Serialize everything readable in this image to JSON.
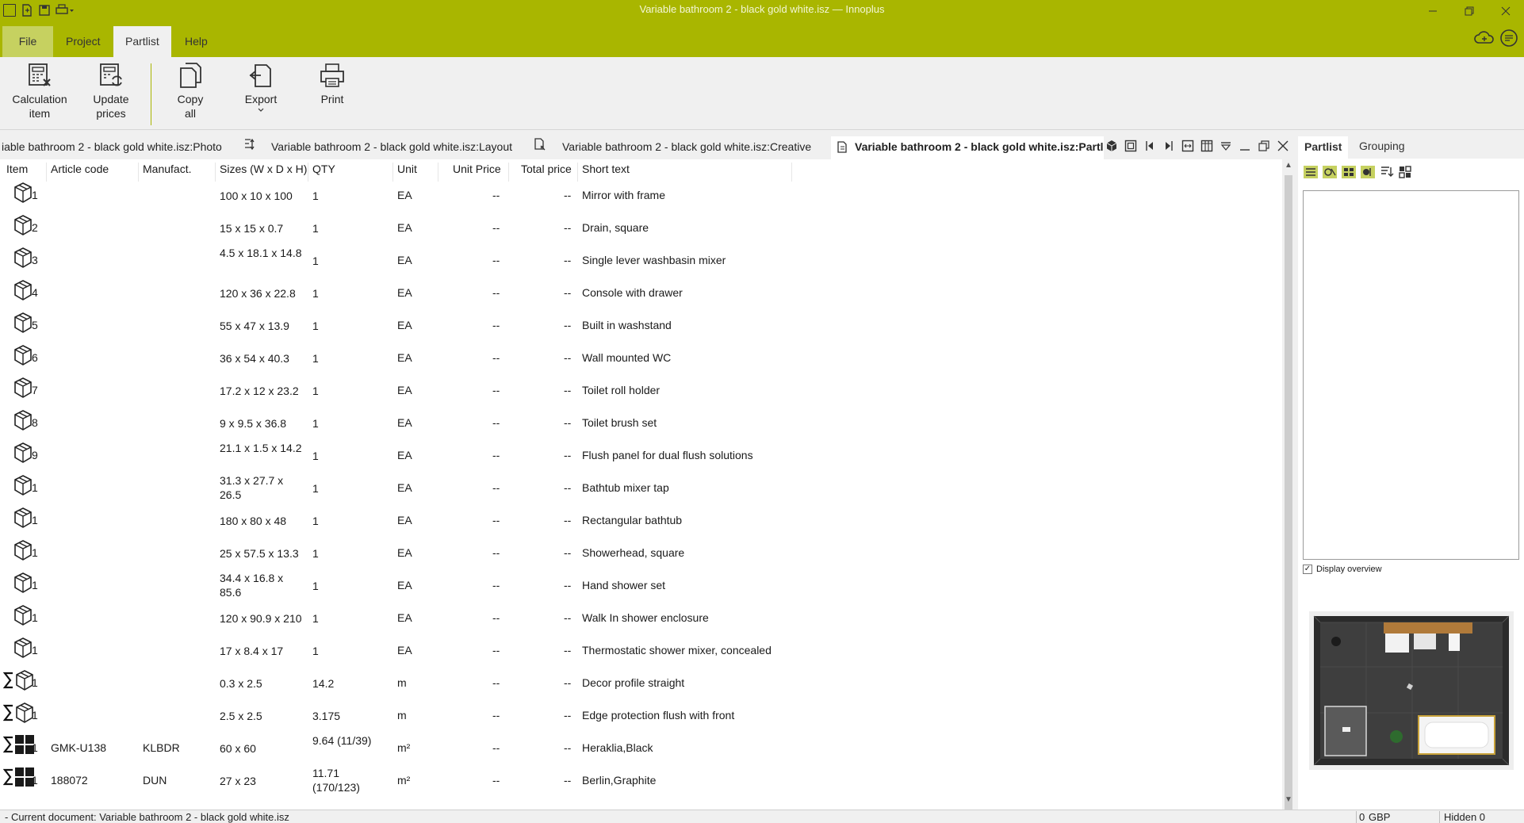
{
  "window": {
    "title": "Variable bathroom 2 - black gold white.isz — Innoplus",
    "controls": [
      "minimize",
      "restore",
      "close"
    ]
  },
  "colors": {
    "accent": "#a9b600",
    "file_tab": "#c6d160"
  },
  "menu": {
    "tabs": [
      {
        "label": "File"
      },
      {
        "label": "Project"
      },
      {
        "label": "Partlist"
      },
      {
        "label": "Help"
      }
    ],
    "active": "Partlist"
  },
  "ribbon": {
    "calc_line1": "Calculation",
    "calc_line2": "item",
    "update_line1": "Update",
    "update_line2": "prices",
    "copy_line1": "Copy",
    "copy_line2": "all",
    "export": "Export",
    "print": "Print"
  },
  "doc_tabs": [
    {
      "label": "iable bathroom 2 - black gold white.isz:Photo"
    },
    {
      "label": "Variable bathroom 2 - black gold white.isz:Layout"
    },
    {
      "label": "Variable bathroom 2 - black gold white.isz:Creative"
    },
    {
      "label": "Variable bathroom 2 - black gold white.isz:Partl"
    }
  ],
  "grid": {
    "columns": [
      "Item",
      "Article code",
      "Manufact.",
      "Sizes (W x D x H)",
      "QTY",
      "Unit",
      "Unit Price",
      "Total price",
      "Short text"
    ],
    "rows": [
      {
        "icon": "box",
        "item": "1",
        "article": "",
        "manuf": "",
        "size": "100 x 10 x 100",
        "qty": "1",
        "unit": "EA",
        "unit_price": "--",
        "total_price": "--",
        "text": "Mirror with frame"
      },
      {
        "icon": "box",
        "item": "2",
        "article": "",
        "manuf": "",
        "size": "15 x 15 x 0.7",
        "qty": "1",
        "unit": "EA",
        "unit_price": "--",
        "total_price": "--",
        "text": "Drain, square"
      },
      {
        "icon": "box",
        "item": "3",
        "article": "",
        "manuf": "",
        "size": "4.5 x 18.1 x 14.8",
        "qty": "1",
        "unit": "EA",
        "unit_price": "--",
        "total_price": "--",
        "text": "Single lever washbasin mixer"
      },
      {
        "icon": "box",
        "item": "4",
        "article": "",
        "manuf": "",
        "size": "120 x 36 x 22.8",
        "qty": "1",
        "unit": "EA",
        "unit_price": "--",
        "total_price": "--",
        "text": "Console with drawer"
      },
      {
        "icon": "box",
        "item": "5",
        "article": "",
        "manuf": "",
        "size": "55 x 47 x 13.9",
        "qty": "1",
        "unit": "EA",
        "unit_price": "--",
        "total_price": "--",
        "text": "Built in washstand"
      },
      {
        "icon": "box",
        "item": "6",
        "article": "",
        "manuf": "",
        "size": "36 x 54 x 40.3",
        "qty": "1",
        "unit": "EA",
        "unit_price": "--",
        "total_price": "--",
        "text": "Wall mounted WC"
      },
      {
        "icon": "box",
        "item": "7",
        "article": "",
        "manuf": "",
        "size": "17.2 x 12 x 23.2",
        "qty": "1",
        "unit": "EA",
        "unit_price": "--",
        "total_price": "--",
        "text": "Toilet roll holder"
      },
      {
        "icon": "box",
        "item": "8",
        "article": "",
        "manuf": "",
        "size": "9 x 9.5 x 36.8",
        "qty": "1",
        "unit": "EA",
        "unit_price": "--",
        "total_price": "--",
        "text": "Toilet brush set"
      },
      {
        "icon": "box",
        "item": "9",
        "article": "",
        "manuf": "",
        "size": "21.1 x 1.5 x 14.2",
        "qty": "1",
        "unit": "EA",
        "unit_price": "--",
        "total_price": "--",
        "text": "Flush panel for dual flush solutions"
      },
      {
        "icon": "box",
        "item": "1",
        "article": "",
        "manuf": "",
        "size": "31.3 x 27.7 x 26.5",
        "qty": "1",
        "unit": "EA",
        "unit_price": "--",
        "total_price": "--",
        "text": "Bathtub mixer tap"
      },
      {
        "icon": "box",
        "item": "1",
        "article": "",
        "manuf": "",
        "size": "180 x 80 x 48",
        "qty": "1",
        "unit": "EA",
        "unit_price": "--",
        "total_price": "--",
        "text": "Rectangular bathtub"
      },
      {
        "icon": "box",
        "item": "1",
        "article": "",
        "manuf": "",
        "size": "25 x 57.5 x 13.3",
        "qty": "1",
        "unit": "EA",
        "unit_price": "--",
        "total_price": "--",
        "text": "Showerhead, square"
      },
      {
        "icon": "box",
        "item": "1",
        "article": "",
        "manuf": "",
        "size": "34.4 x 16.8 x 85.6",
        "qty": "1",
        "unit": "EA",
        "unit_price": "--",
        "total_price": "--",
        "text": "Hand shower set"
      },
      {
        "icon": "box",
        "item": "1",
        "article": "",
        "manuf": "",
        "size": "120 x 90.9 x 210",
        "qty": "1",
        "unit": "EA",
        "unit_price": "--",
        "total_price": "--",
        "text": "Walk In shower enclosure"
      },
      {
        "icon": "box",
        "item": "1",
        "article": "",
        "manuf": "",
        "size": "17 x 8.4 x 17",
        "qty": "1",
        "unit": "EA",
        "unit_price": "--",
        "total_price": "--",
        "text": "Thermostatic shower mixer, concealed"
      },
      {
        "icon": "sum-box",
        "item": "1",
        "article": "",
        "manuf": "",
        "size": "0.3 x 2.5",
        "qty": "14.2",
        "unit": "m",
        "unit_price": "--",
        "total_price": "--",
        "text": "Decor profile straight"
      },
      {
        "icon": "sum-box",
        "item": "1",
        "article": "",
        "manuf": "",
        "size": "2.5 x 2.5",
        "qty": "3.175",
        "unit": "m",
        "unit_price": "--",
        "total_price": "--",
        "text": "Edge protection flush with front"
      },
      {
        "icon": "sum-tile",
        "item": "1",
        "article": "GMK-U138",
        "manuf": "KLBDR",
        "size": "60 x 60",
        "qty": "9.64 (11/39)",
        "unit": "m²",
        "unit_price": "--",
        "total_price": "--",
        "text": "Heraklia,Black"
      },
      {
        "icon": "sum-tile",
        "item": "1",
        "article": "188072",
        "manuf": "DUN",
        "size": "27 x 23",
        "qty": "11.71 (170/123)",
        "unit": "m²",
        "unit_price": "--",
        "total_price": "--",
        "text": "Berlin,Graphite"
      }
    ]
  },
  "right_panel": {
    "tabs": [
      "Partlist",
      "Grouping"
    ],
    "display_overview_label": "Display overview",
    "display_overview_checked": true
  },
  "status": {
    "document": "- Current document: Variable bathroom 2 - black gold white.isz",
    "amount": "0",
    "currency": "GBP",
    "hidden": "Hidden 0"
  }
}
